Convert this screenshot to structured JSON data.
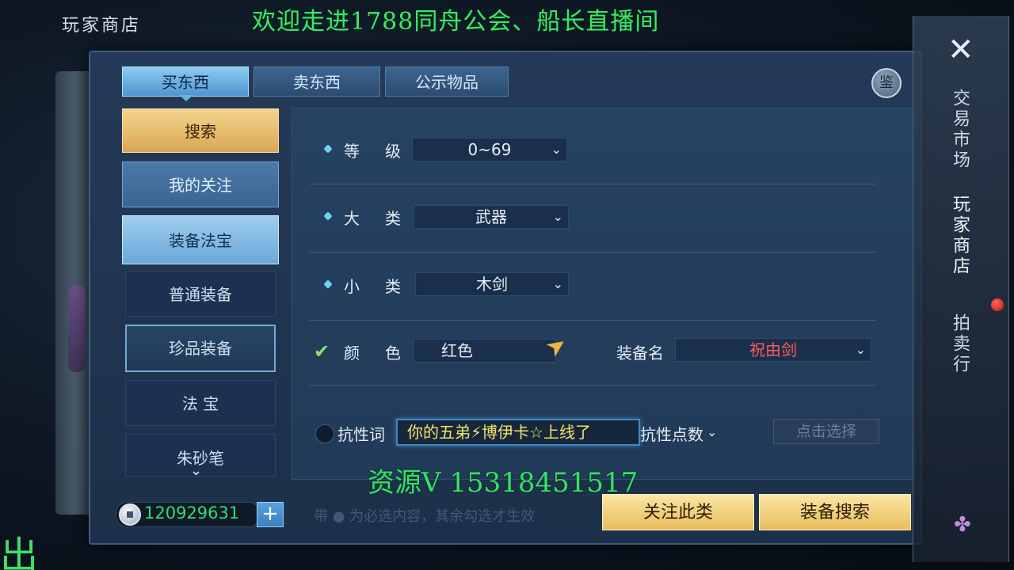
{
  "corner_title": "玩家商店",
  "overlay_banner": "欢迎走进1788同舟公会、船长直播间",
  "tabs": [
    {
      "label": "买东西",
      "active": true
    },
    {
      "label": "卖东西",
      "active": false
    },
    {
      "label": "公示物品",
      "active": false
    }
  ],
  "appraise_label": "鉴",
  "side_menu": {
    "items": [
      {
        "label": "搜索",
        "style": "gold"
      },
      {
        "label": "我的关注",
        "style": "light"
      },
      {
        "label": "装备法宝",
        "style": "selected"
      },
      {
        "label": "普通装备",
        "style": "dark"
      },
      {
        "label": "珍品装备",
        "style": "outlined"
      },
      {
        "label": "法 宝",
        "style": "dark"
      },
      {
        "label": "朱砂笔",
        "style": "dark"
      }
    ],
    "more_icon": "chevron-down-icon"
  },
  "filters": {
    "level": {
      "label1": "等",
      "label2": "级",
      "value": "0~69"
    },
    "category": {
      "label1": "大",
      "label2": "类",
      "value": "武器"
    },
    "subcategory": {
      "label1": "小",
      "label2": "类",
      "value": "木剑"
    },
    "color": {
      "label1": "颜",
      "label2": "色",
      "value": "红色",
      "checked": true
    },
    "equip_name": {
      "label": "装备名",
      "value": "祝由剑",
      "value_color": "#ff5a5a"
    },
    "resist_label": "抗性词",
    "resist_points_label": "抗性点数",
    "pick_button": "点击选择"
  },
  "toast": "你的五弟⚡博伊卡☆上线了",
  "watermark": "资源V 15318451517",
  "footer": {
    "currency": "120929631",
    "plus_label": "+",
    "hint": "带 ● 为必选内容，其余勾选才生效",
    "follow_button": "关注此类",
    "search_button": "装备搜索"
  },
  "right_rail": {
    "close_icon": "close-icon",
    "items": [
      {
        "label": "交易市场",
        "active": false
      },
      {
        "label": "玩家商店",
        "active": true
      },
      {
        "label": "拍卖行",
        "active": false
      }
    ],
    "notification": true
  },
  "corner_overlay_text": "出",
  "colors": {
    "accent_green": "#39e86a",
    "gold_button": "#e8bd5b",
    "equip_name_red": "#ff5a5a",
    "tab_active": "#6aa8da"
  }
}
